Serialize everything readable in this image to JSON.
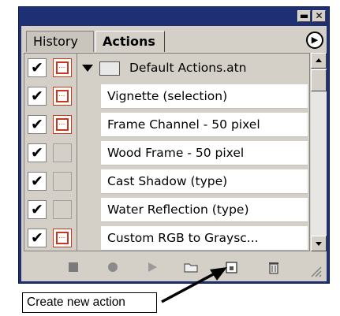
{
  "tabs": [
    {
      "label": "History",
      "active": false
    },
    {
      "label": "Actions",
      "active": true
    }
  ],
  "action_set": {
    "name": "Default Actions.atn",
    "expanded": true
  },
  "actions": [
    {
      "name": "Vignette (selection)",
      "enabled": true,
      "dialog": true
    },
    {
      "name": "Frame Channel - 50 pixel",
      "enabled": true,
      "dialog": true
    },
    {
      "name": "Wood Frame - 50 pixel",
      "enabled": true,
      "dialog": false
    },
    {
      "name": "Cast Shadow (type)",
      "enabled": true,
      "dialog": false
    },
    {
      "name": "Water Reflection (type)",
      "enabled": true,
      "dialog": false
    },
    {
      "name": "Custom RGB to Graysc...",
      "enabled": true,
      "dialog": true
    }
  ],
  "toolbar_icons": [
    "stop-icon",
    "record-icon",
    "play-icon",
    "new-set-icon",
    "new-action-icon",
    "trash-icon"
  ],
  "callout": {
    "text": "Create new action"
  },
  "colors": {
    "titlebar": "#1f2f74",
    "panel": "#d4d0c8",
    "dialog_accent": "#c8361c"
  }
}
